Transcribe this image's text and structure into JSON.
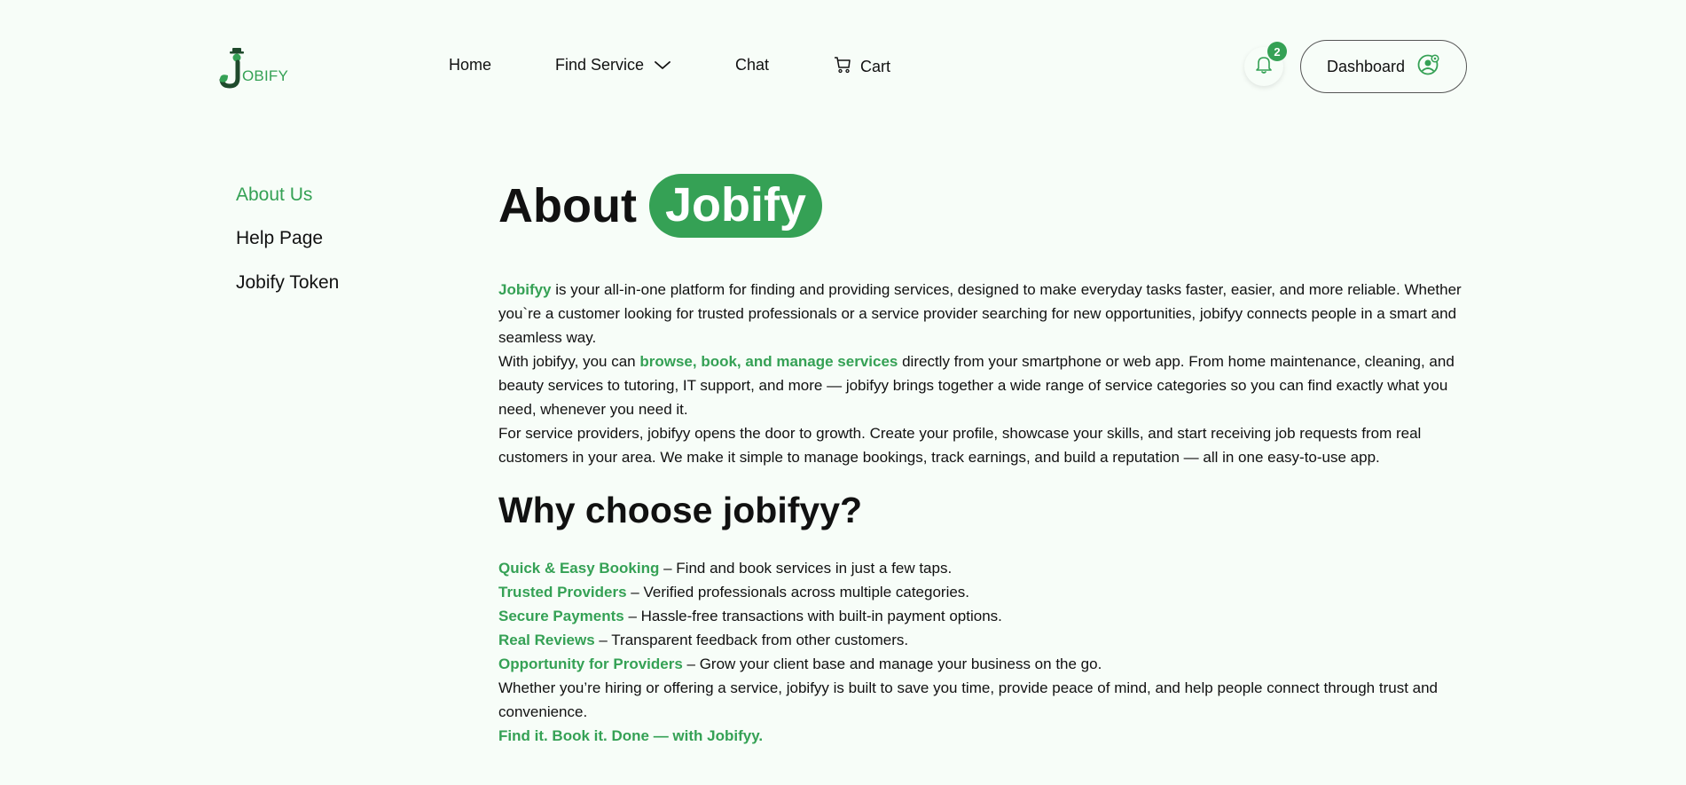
{
  "brand": {
    "logo_text": "OBIFY",
    "accent": "#35a155",
    "background": "#f7fdf8"
  },
  "nav": {
    "home": "Home",
    "find_service": "Find Service",
    "chat": "Chat",
    "cart": "Cart"
  },
  "header": {
    "notification_count": "2",
    "dashboard_label": "Dashboard"
  },
  "sidebar": {
    "items": [
      {
        "label": "About Us",
        "active": true
      },
      {
        "label": "Help Page",
        "active": false
      },
      {
        "label": "Jobify Token",
        "active": false
      }
    ]
  },
  "main": {
    "title_prefix": "About",
    "title_highlight": "Jobify",
    "p1_brand": "Jobifyy",
    "p1_rest": " is your all-in-one platform for finding and providing services, designed to make everyday tasks faster, easier, and more reliable. Whether you`re a customer looking for trusted professionals or a service provider searching for new opportunities, jobifyy connects people in a smart and seamless way.",
    "p2_start": "With jobifyy, you can ",
    "p2_highlight": "browse, book, and manage services",
    "p2_rest": " directly from your smartphone or web app. From home maintenance, cleaning, and beauty services to tutoring, IT support, and more — jobifyy brings together a wide range of service categories so you can find exactly what you need, whenever you need it.",
    "p3": "For service providers, jobifyy opens the door to growth. Create your profile, showcase your skills, and start receiving job requests from real customers in your area. We make it simple to manage bookings, track earnings, and build a reputation — all in one easy-to-use app.",
    "why_heading": "Why choose jobifyy?",
    "features": [
      {
        "title": "Quick & Easy Booking",
        "desc": " – Find and book services in just a few taps."
      },
      {
        "title": "Trusted Providers",
        "desc": " – Verified professionals across multiple categories."
      },
      {
        "title": "Secure Payments",
        "desc": " – Hassle-free transactions with built-in payment options."
      },
      {
        "title": "Real Reviews",
        "desc": " – Transparent feedback from other customers."
      },
      {
        "title": "Opportunity for Providers",
        "desc": " – Grow your client base and manage your business on the go."
      }
    ],
    "closing": "Whether you’re hiring or offering a service, jobifyy is built to save you time, provide peace of mind, and help people connect through trust and convenience.",
    "tagline": "Find it. Book it. Done — with Jobifyy."
  }
}
